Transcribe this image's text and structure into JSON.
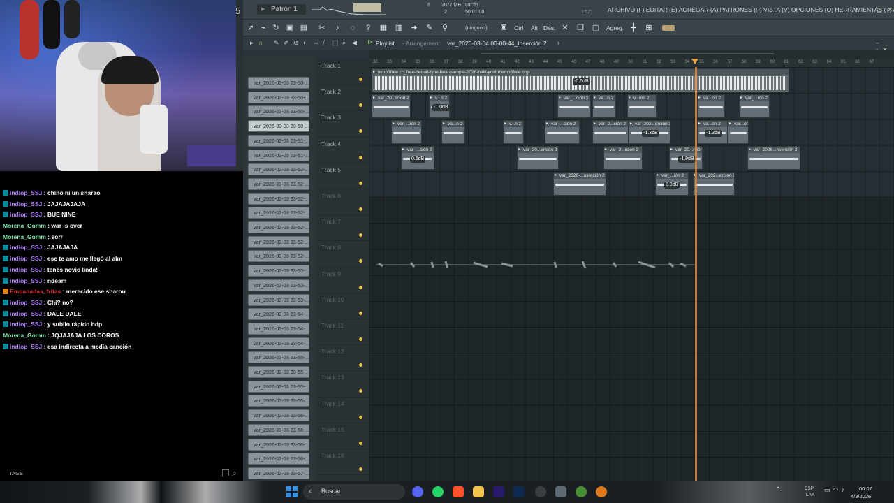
{
  "stream": {
    "chat": [
      {
        "user": "indiop_SSJ",
        "text": ": chino ni un sharao",
        "color": "#b07dff",
        "badge": "teal"
      },
      {
        "user": "indiop_SSJ",
        "text": ": JAJAJAJAJA",
        "color": "#b07dff",
        "badge": "teal"
      },
      {
        "user": "indiop_SSJ",
        "text": ": BUE NINE",
        "color": "#b07dff",
        "badge": "teal"
      },
      {
        "user": "Morena_Gomm",
        "text": ": war is over",
        "color": "#7be0a8",
        "badge": ""
      },
      {
        "user": "Morena_Gomm",
        "text": ": sorr",
        "color": "#7be0a8",
        "badge": ""
      },
      {
        "user": "indiop_SSJ",
        "text": ": JAJAJAJA",
        "color": "#b07dff",
        "badge": "teal"
      },
      {
        "user": "indiop_SSJ",
        "text": ": ese te amo me llegó al alm",
        "color": "#b07dff",
        "badge": "teal"
      },
      {
        "user": "indiop_SSJ",
        "text": ": tenés novio linda!",
        "color": "#b07dff",
        "badge": "teal"
      },
      {
        "user": "indiop_SSJ",
        "text": ": ndeam",
        "color": "#b07dff",
        "badge": "teal"
      },
      {
        "user": "Empanadas_fritas",
        "text": ": merecido ese sharou",
        "color": "#d9363e",
        "badge": "orange"
      },
      {
        "user": "indiop_SSJ",
        "text": ": Chi? no?",
        "color": "#b07dff",
        "badge": "teal"
      },
      {
        "user": "indiop_SSJ",
        "text": ": DALE DALE",
        "color": "#b07dff",
        "badge": "teal"
      },
      {
        "user": "indiop_SSJ",
        "text": ": y subilo rápido hdp",
        "color": "#b07dff",
        "badge": "teal"
      },
      {
        "user": "Morena_Gomm",
        "text": ": JQJAJAJA LOS COROS",
        "color": "#7be0a8",
        "badge": ""
      },
      {
        "user": "indiop_SSJ",
        "text": ": esa indirecta a media canción",
        "color": "#b07dff",
        "badge": "teal"
      }
    ],
    "tags_label": "TAGS"
  },
  "fl": {
    "top": {
      "big5": "5",
      "pattern": "Patrón 1",
      "cpu_num": "8",
      "mem": "2077 MB",
      "mem2": "2",
      "file": "var.flp",
      "file_time": "50:01:00",
      "sec": "1'52\"",
      "menu": "ARCHIVO (F) EDITAR (E) AGREGAR (A) PATRONES (P) VISTA (V) OPCIONES (O) HERRAMIENTAS (T) AYUDA",
      "window_controls": "–◻✕"
    },
    "toolbar": {
      "ninguno": "(ninguno)",
      "ctrl": "Ctrl",
      "alt": "Alt",
      "des": "Des.",
      "agreg": "Agreg."
    },
    "playlist": {
      "title": "Playlist",
      "sub": "- Arrangement",
      "arrangement": "var_2026-03-04 00-00-44_Inserción 2",
      "arrow": "›",
      "controls": "–▫✕"
    },
    "clip_list": [
      "var_2026-03-03 23-50-...",
      "var_2026-03-03 23-50-...",
      "var_2026-03-03 23-50-...",
      "var_2026-03-03 23-50-...",
      "var_2026-03-03 23-51-...",
      "var_2026-03-03 23-51-...",
      "var_2026-03-03 23-52-...",
      "var_2026-03-03 23-52-...",
      "var_2026-03-03 23-52-...",
      "var_2026-03-03 23-52-...",
      "var_2026-03-03 23-52-...",
      "var_2026-03-03 23-52-...",
      "var_2026-03-03 23-52-...",
      "var_2026-03-03 23-53-...",
      "var_2026-03-03 23-53-...",
      "var_2026-03-03 23-53-...",
      "var_2026-03-03 23-54-...",
      "var_2026-03-03 23-54-...",
      "var_2026-03-03 23-54-...",
      "var_2026-03-03 23-55-...",
      "var_2026-03-03 23-55-...",
      "var_2026-03-03 23-55-...",
      "var_2026-03-03 23-55-...",
      "var_2026-03-03 23-56-...",
      "var_2026-03-03 23-56-...",
      "var_2026-03-03 23-56-...",
      "var_2026-03-03 23-56-...",
      "var_2026-03-03 23-57-..."
    ],
    "tracks": [
      "Track 1",
      "Track 2",
      "Track 3",
      "Track 4",
      "Track 5",
      "Track 6",
      "Track 7",
      "Track 8",
      "Track 9",
      "Track 10",
      "Track 11",
      "Track 12",
      "Track 13",
      "Track 14",
      "Track 15",
      "Track 16"
    ],
    "ruler": [
      "32",
      "33",
      "34",
      "35",
      "36",
      "37",
      "38",
      "39",
      "40",
      "41",
      "42",
      "43",
      "44",
      "45",
      "46",
      "47",
      "48",
      "49",
      "50",
      "51",
      "52",
      "53",
      "54",
      "55",
      "56",
      "57",
      "58",
      "59",
      "60",
      "61",
      "62",
      "63",
      "64",
      "65",
      "66",
      "67"
    ],
    "clips": {
      "t1": {
        "title": "ytmp3free.cc_free-detroit-type-beat-sample-2026-haiti-youtubemp3free.org",
        "gain": "-0.6dB"
      },
      "t2": [
        {
          "title": "var_20...rción 2",
          "gain": ""
        },
        {
          "title": "v...n 2",
          "gain": "-1.0dB"
        },
        {
          "title": "var_...ción 2",
          "gain": ""
        },
        {
          "title": "va...n 2",
          "gain": ""
        },
        {
          "title": "v...ión 2",
          "gain": ""
        },
        {
          "title": "va...ón 2",
          "gain": ""
        },
        {
          "title": "var_...ión 2",
          "gain": ""
        }
      ],
      "t3": [
        {
          "title": "var_...ión 2",
          "gain": ""
        },
        {
          "title": "va...n 2",
          "gain": ""
        },
        {
          "title": "v...n 2",
          "gain": ""
        },
        {
          "title": "var_...ción 2",
          "gain": ""
        },
        {
          "title": "var_2...ción 2",
          "gain": ""
        },
        {
          "title": "var_202...erción 2",
          "gain": "-1.3dB"
        },
        {
          "title": "va...ón 2",
          "gain": "-1.3dB"
        },
        {
          "title": "var...ón 2",
          "gain": ""
        }
      ],
      "t4": [
        {
          "title": "var_...ción 2",
          "gain": "0.6dB"
        },
        {
          "title": "var_20...erción 2",
          "gain": ""
        },
        {
          "title": "var_2...rción 2",
          "gain": ""
        },
        {
          "title": "var_20...rción 2",
          "gain": "-1.9dB"
        },
        {
          "title": "var_2026...nserción 2",
          "gain": ""
        }
      ],
      "t5": [
        {
          "title": "var_2026-...nserción 2",
          "gain": ""
        },
        {
          "title": "var_...ión 2",
          "gain": "0.8dB"
        },
        {
          "title": "var_202...erción 2",
          "gain": ""
        }
      ]
    }
  },
  "taskbar": {
    "search": "Buscar",
    "lang1": "ESP",
    "lang2": "LAA",
    "time": "00:07",
    "date": "4/3/2026"
  },
  "colors": {
    "playhead": "#e08a3c",
    "track_dot": "#e8c64a",
    "chat_purple": "#b07dff",
    "chat_green": "#7be0a8",
    "chat_red": "#d9363e"
  }
}
